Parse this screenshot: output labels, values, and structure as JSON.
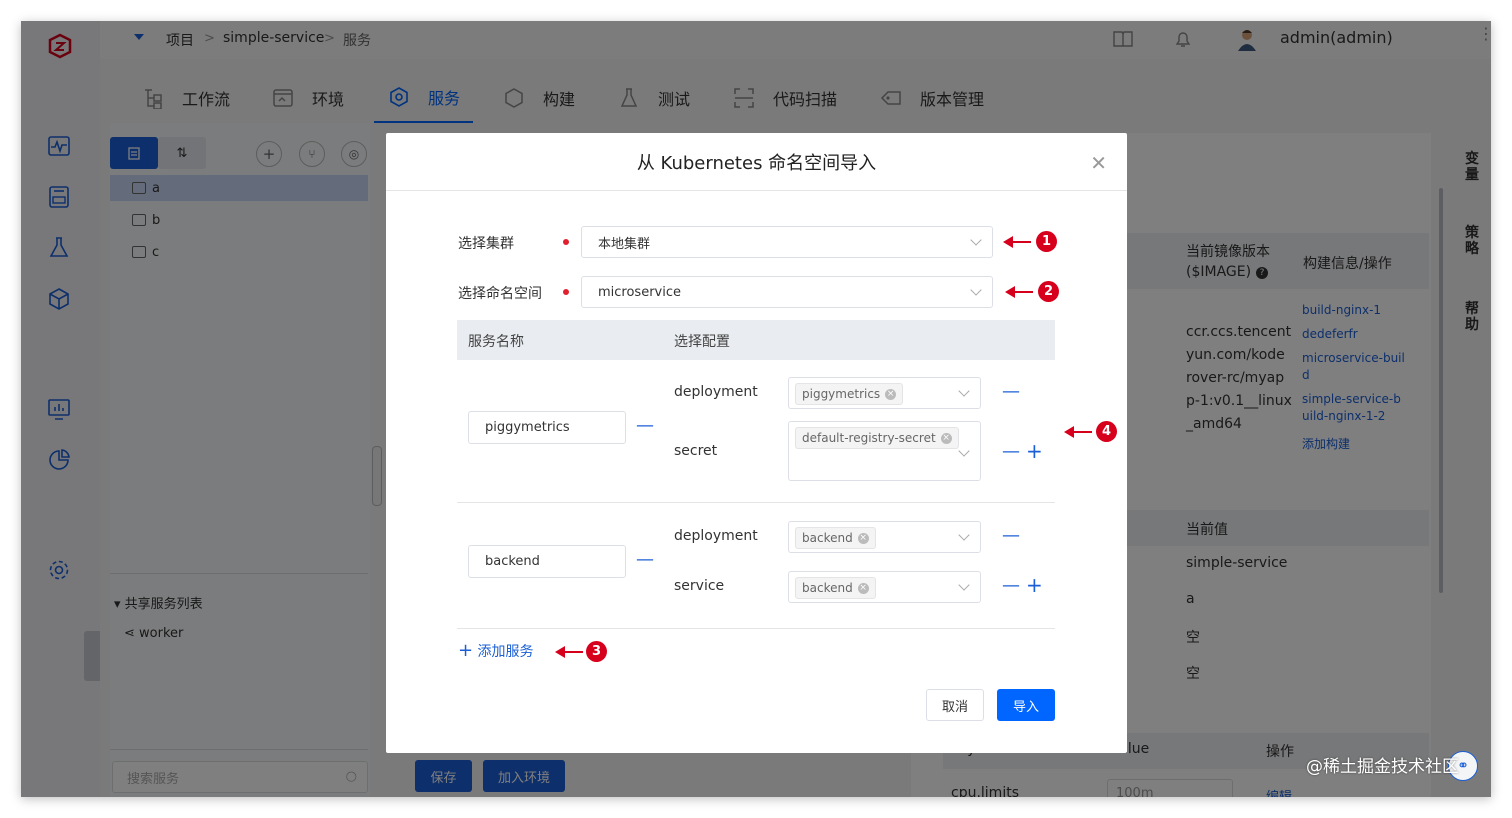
{
  "breadcrumb": {
    "root": "项目",
    "project": "simple-service",
    "page": "服务",
    "sep": ">"
  },
  "user": {
    "name": "admin(admin)"
  },
  "tabs": [
    {
      "label": "工作流",
      "icon": "workflow-icon"
    },
    {
      "label": "环境",
      "icon": "env-icon"
    },
    {
      "label": "服务",
      "icon": "service-icon"
    },
    {
      "label": "构建",
      "icon": "build-icon"
    },
    {
      "label": "测试",
      "icon": "test-icon"
    },
    {
      "label": "代码扫描",
      "icon": "scan-icon"
    },
    {
      "label": "版本管理",
      "icon": "version-icon"
    }
  ],
  "tree": {
    "items": [
      "a",
      "b",
      "c"
    ],
    "shared_title": "共享服务列表",
    "shared_items": [
      "worker"
    ],
    "search_placeholder": "搜索服务",
    "save_label": "保存",
    "join_env_label": "加入环境"
  },
  "right_panel": {
    "col_image": "当前镜像版本",
    "col_image_sub": "($IMAGE)",
    "col_build": "构建信息/操作",
    "image_lines": [
      "ccr.ccs.tencent",
      "yun.com/kode",
      "rover-rc/myap",
      "p-1:v0.1__linux",
      "_amd64"
    ],
    "builds": [
      "build-nginx-1",
      "dedeferfr",
      "microservice-buil",
      "d",
      "simple-service-b",
      "uild-nginx-1-2"
    ],
    "add_build": "添加构建",
    "col_current": "当前值",
    "current_values": [
      "simple-service",
      "a",
      "空",
      "空"
    ],
    "col_key": "key",
    "col_value": "value",
    "col_op": "操作",
    "row_key": "cpu.limits",
    "row_value": "100m",
    "row_edit": "编辑",
    "vtabs": [
      "变量",
      "策略",
      "帮助"
    ]
  },
  "modal": {
    "title": "从 Kubernetes 命名空间导入",
    "cluster_label": "选择集群",
    "cluster_value": "本地集群",
    "namespace_label": "选择命名空间",
    "namespace_value": "microservice",
    "col_service": "服务名称",
    "col_config": "选择配置",
    "services": [
      {
        "name": "piggymetrics",
        "configs": [
          {
            "kind": "deployment",
            "tag": "piggymetrics"
          },
          {
            "kind": "secret",
            "tag": "default-registry-secret"
          }
        ]
      },
      {
        "name": "backend",
        "configs": [
          {
            "kind": "deployment",
            "tag": "backend"
          },
          {
            "kind": "service",
            "tag": "backend"
          }
        ]
      }
    ],
    "add_service": "添加服务",
    "cancel": "取消",
    "import": "导入"
  },
  "annotations": [
    "1",
    "2",
    "3",
    "4"
  ],
  "watermark": "@稀土掘金技术社区",
  "colors": {
    "primary": "#0066ff",
    "annotation": "#d6001c",
    "required": "#e0202e"
  }
}
